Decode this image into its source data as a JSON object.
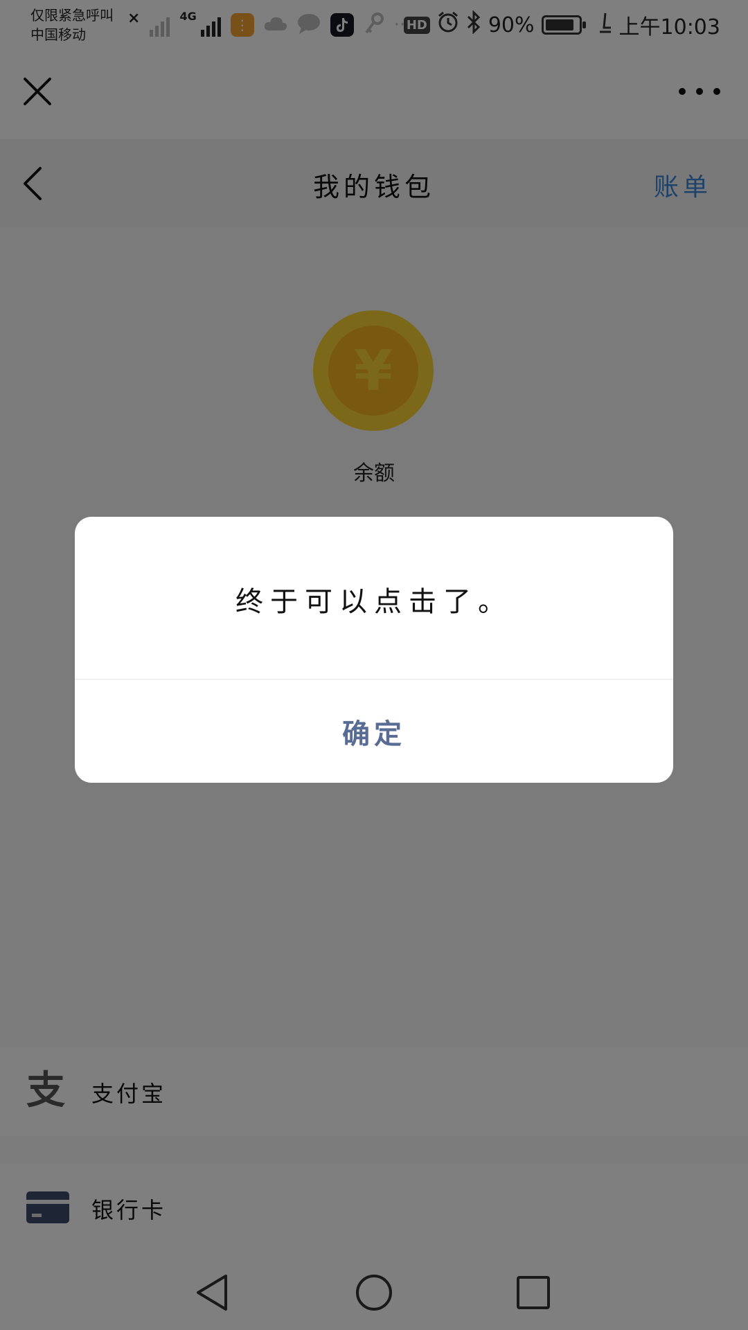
{
  "status_bar": {
    "carrier_line1": "仅限紧急呼叫",
    "carrier_line2": "中国移动",
    "network_type": "4G",
    "battery_percent": "90%",
    "battery_level": 0.9,
    "time": "上午10:03",
    "hd_label": "HD",
    "more_notifications": "···"
  },
  "action_bar": {
    "close_icon": "close-icon",
    "more_icon": "more-dots-icon"
  },
  "nav": {
    "title": "我的钱包",
    "right_action": "账单",
    "back_icon": "chevron-left-icon"
  },
  "wallet": {
    "coin_symbol": "¥",
    "balance_label": "余额"
  },
  "payment_methods": [
    {
      "label": "支付宝",
      "icon": "alipay-icon",
      "glyph": "支"
    },
    {
      "label": "银行卡",
      "icon": "bank-card-icon"
    }
  ],
  "dialog": {
    "message": "终于可以点击了。",
    "confirm_label": "确定"
  },
  "colors": {
    "accent_blue": "#3a86d4",
    "dialog_button": "#586c94",
    "coin_outer": "#f7d232",
    "coin_inner": "#f0b21f",
    "overlay": "rgba(0,0,0,0.5)"
  }
}
